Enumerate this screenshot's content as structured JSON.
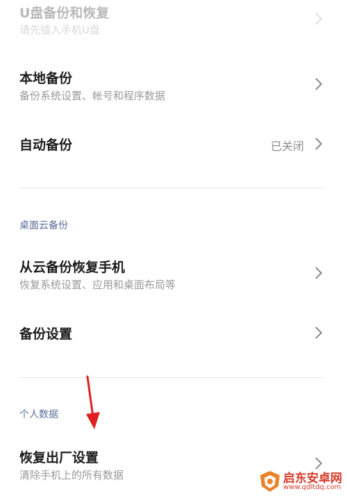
{
  "items": {
    "usb": {
      "title": "U盘备份和恢复",
      "subtitle": "请先插入手机U盘"
    },
    "local": {
      "title": "本地备份",
      "subtitle": "备份系统设置、帐号和程序数据"
    },
    "auto": {
      "title": "自动备份",
      "value": "已关闭"
    },
    "cloud_restore": {
      "title": "从云备份恢复手机",
      "subtitle": "恢复系统设置、应用和桌面布局等"
    },
    "backup_settings": {
      "title": "备份设置"
    },
    "factory_reset": {
      "title": "恢复出厂设置",
      "subtitle": "清除手机上的所有数据"
    }
  },
  "sections": {
    "desktop_cloud": "桌面云备份",
    "personal_data": "个人数据"
  },
  "watermark": {
    "brand": "启东安卓网",
    "url": "www.qdltdq.com"
  },
  "colors": {
    "accent_section": "#5b6f99",
    "arrow": "#e02020",
    "watermark": "#d63b2a"
  },
  "icons": {
    "chevron": "chevron-right-icon",
    "annotation": "red-arrow-down-icon"
  }
}
